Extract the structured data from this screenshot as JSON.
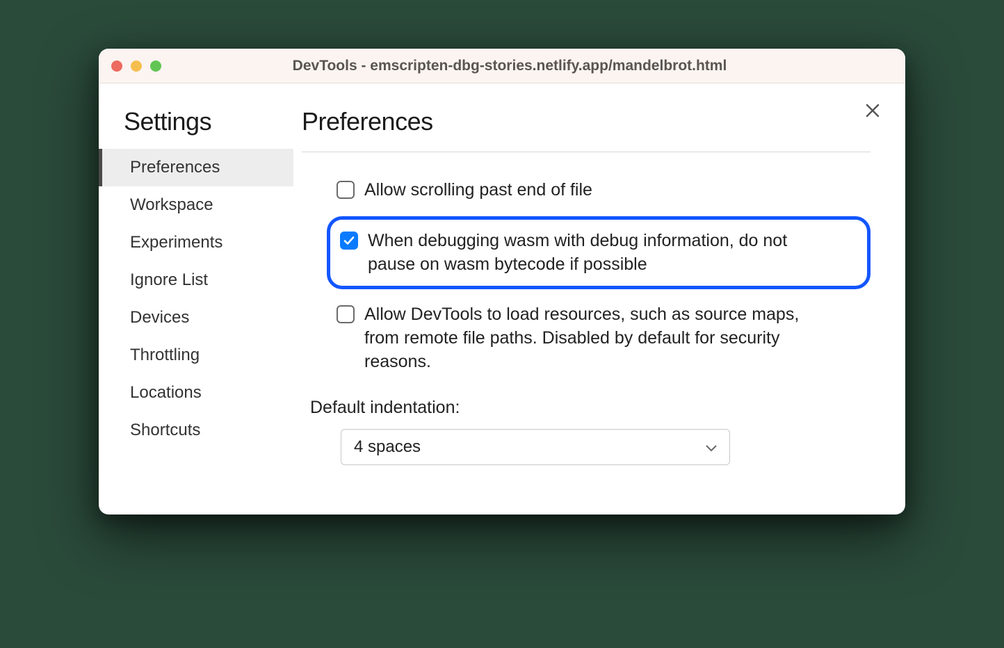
{
  "titlebar": {
    "title": "DevTools - emscripten-dbg-stories.netlify.app/mandelbrot.html"
  },
  "sidebar": {
    "title": "Settings",
    "items": [
      {
        "label": "Preferences",
        "active": true
      },
      {
        "label": "Workspace"
      },
      {
        "label": "Experiments"
      },
      {
        "label": "Ignore List"
      },
      {
        "label": "Devices"
      },
      {
        "label": "Throttling"
      },
      {
        "label": "Locations"
      },
      {
        "label": "Shortcuts"
      }
    ]
  },
  "main": {
    "title": "Preferences",
    "options": [
      {
        "label": "Allow scrolling past end of file",
        "checked": false,
        "highlighted": false
      },
      {
        "label": "When debugging wasm with debug information, do not pause on wasm bytecode if possible",
        "checked": true,
        "highlighted": true
      },
      {
        "label": "Allow DevTools to load resources, such as source maps, from remote file paths. Disabled by default for security reasons.",
        "checked": false,
        "highlighted": false
      }
    ],
    "indentation": {
      "label": "Default indentation:",
      "value": "4 spaces"
    }
  }
}
